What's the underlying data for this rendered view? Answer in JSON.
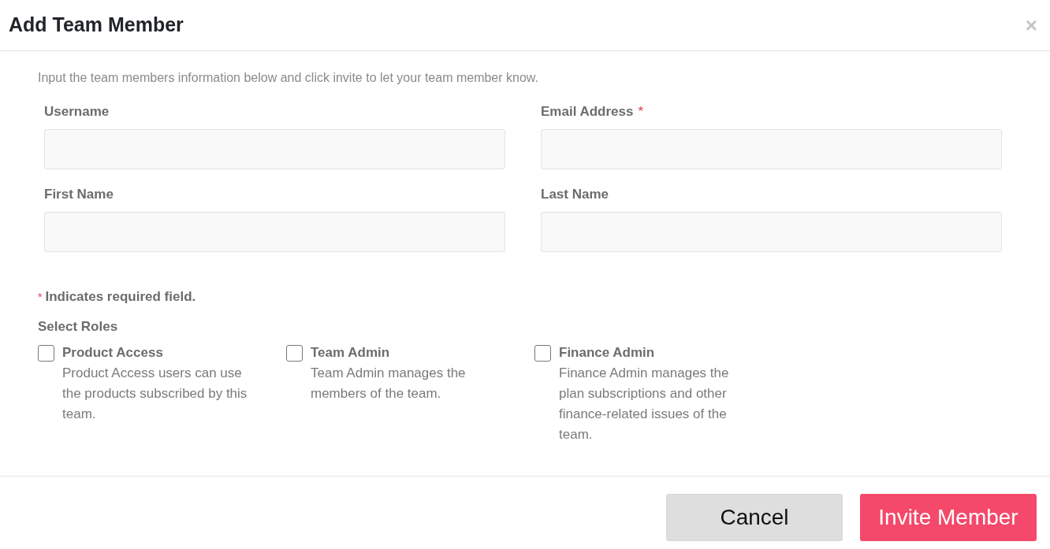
{
  "dialog": {
    "title": "Add Team Member",
    "close": "×"
  },
  "intro": "Input the team members information below and click invite to let your team member know.",
  "required_marker": "*",
  "fields": [
    {
      "label": "Username",
      "required": false
    },
    {
      "label": "Email Address",
      "required": true
    },
    {
      "label": "First Name",
      "required": false
    },
    {
      "label": "Last Name",
      "required": false
    }
  ],
  "required_note": "Indicates required field.",
  "roles_heading": "Select Roles",
  "roles": [
    {
      "name": "Product Access",
      "description": "Product Access users can use the products subscribed by this team.",
      "checked": false
    },
    {
      "name": "Team Admin",
      "description": "Team Admin manages the members of the team.",
      "checked": false
    },
    {
      "name": "Finance Admin",
      "description": "Finance Admin manages the plan subscriptions and other finance-related issues of the team.",
      "checked": false
    }
  ],
  "buttons": [
    {
      "label": "Cancel",
      "kind": "secondary"
    },
    {
      "label": "Invite Member",
      "kind": "primary"
    }
  ]
}
